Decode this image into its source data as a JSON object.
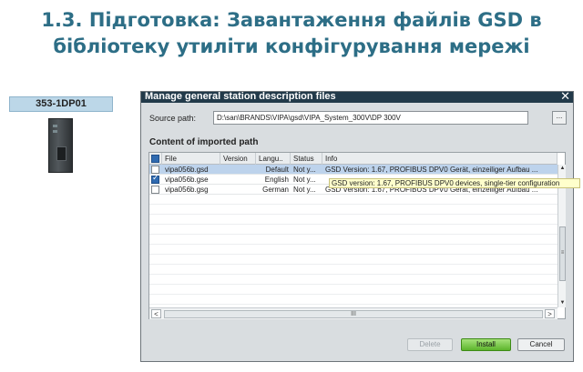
{
  "slide": {
    "title_line1": "1.3. Підготовка: Завантаження файлів GSD в",
    "title_line2": "бібліотеку утиліти конфігурування мережі"
  },
  "device": {
    "label": "353-1DP01"
  },
  "dialog": {
    "title": "Manage general station description files",
    "close_glyph": "✕",
    "source_label": "Source path:",
    "source_value": "D:\\san\\BRANDS\\VIPA\\gsd\\VIPA_System_300V\\DP 300V",
    "browse_label": "...",
    "section_title": "Content of imported path",
    "columns": [
      "File",
      "Version",
      "Langu..",
      "Status",
      "Info"
    ],
    "rows": [
      {
        "file": "vipa056b.gsd",
        "version": "",
        "language": "Default",
        "status": "Not y...",
        "info": "GSD Version: 1.67, PROFIBUS DPV0 Gerät, einzeiliger Aufbau ...",
        "checked": false,
        "selected": true
      },
      {
        "file": "vipa056b.gse",
        "version": "",
        "language": "English",
        "status": "Not y...",
        "info": "GSD version: 1.67, PROFIBUS DPV0 devices, single-tier configuration",
        "checked": true,
        "selected": false
      },
      {
        "file": "vipa056b.gsg",
        "version": "",
        "language": "German",
        "status": "Not y...",
        "info": "GSD Version: 1.67, PROFIBUS DPV0 Gerät, einzeiliger Aufbau ...",
        "checked": false,
        "selected": false
      }
    ],
    "tooltip": "GSD version: 1.67, PROFIBUS DPV0 devices, single-tier configuration",
    "scroll": {
      "up": "▲",
      "down": "▼",
      "thumb": "≡",
      "left": "<",
      "right": ">",
      "hthumb": "III"
    },
    "buttons": {
      "delete": "Delete",
      "install": "Install",
      "cancel": "Cancel"
    }
  }
}
